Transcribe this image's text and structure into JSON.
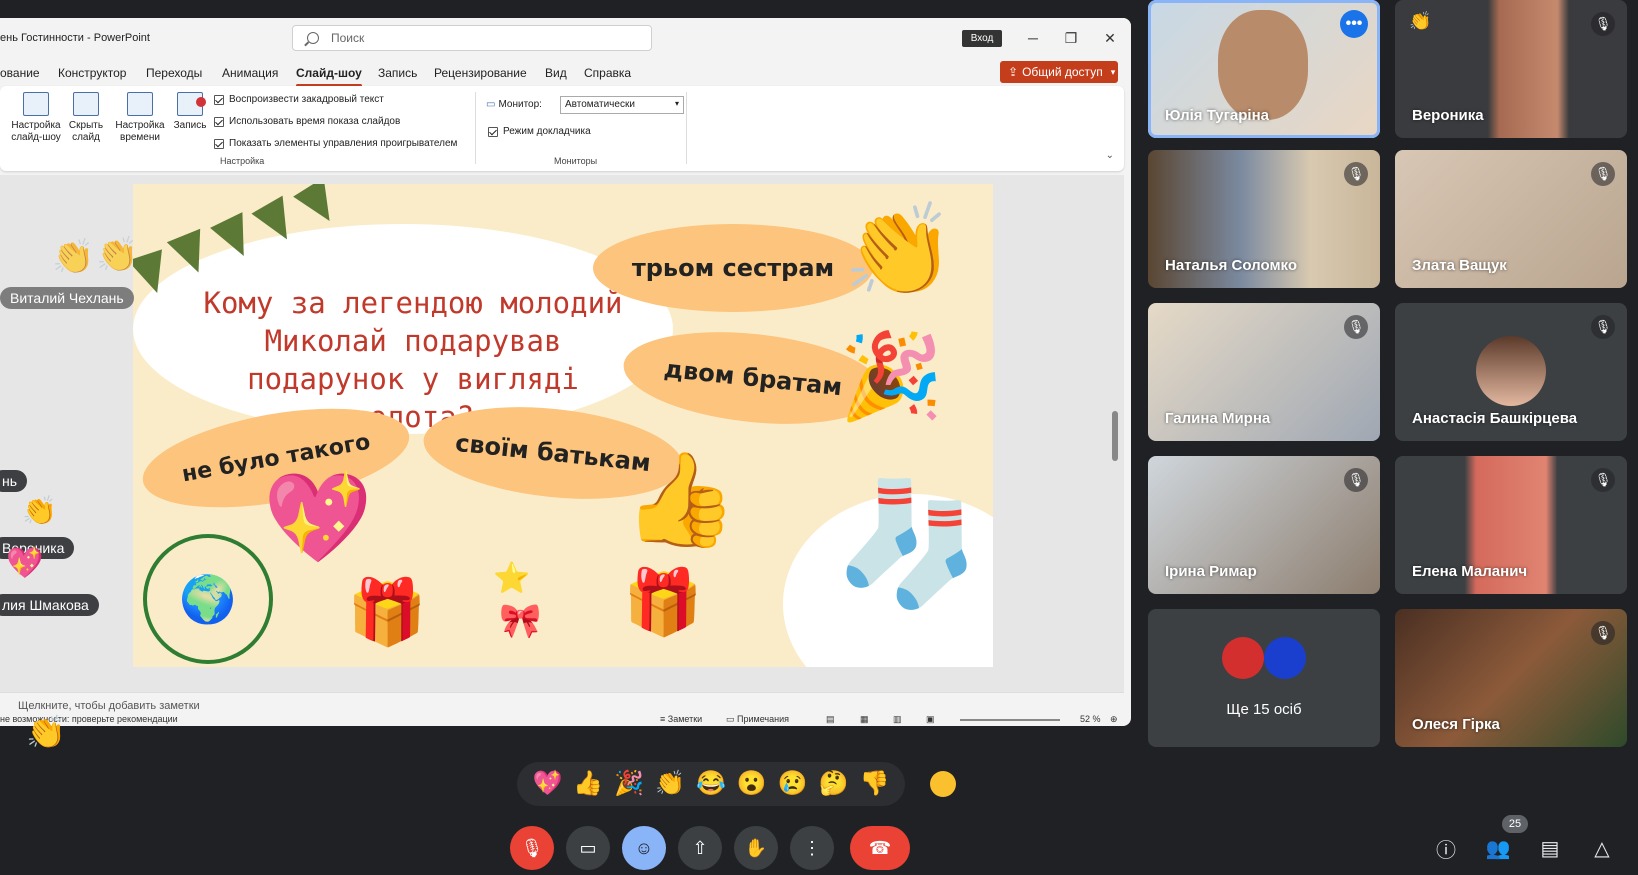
{
  "powerpoint": {
    "doc_title": "ень Гостинности  -  PowerPoint",
    "search_placeholder": "Поиск",
    "login_label": "Вход",
    "menu": [
      "ование",
      "Конструктор",
      "Переходы",
      "Анимация",
      "Слайд-шоу",
      "Запись",
      "Рецензирование",
      "Вид",
      "Справка"
    ],
    "active_menu": "Слайд-шоу",
    "share_label": "Общий доступ",
    "ribbon": {
      "btn_setup": "Настройка слайд-шоу",
      "btn_hide": "Скрыть слайд",
      "btn_rehearse": "Настройка времени",
      "btn_record": "Запись",
      "chk_narration": "Воспроизвести закадровый текст",
      "chk_timings": "Использовать время показа слайдов",
      "chk_controls": "Показать элементы управления проигрывателем",
      "group_setup": "Настройка",
      "monitor_label": "Монитор:",
      "monitor_value": "Автоматически",
      "presenter_view": "Режим докладчика",
      "group_monitors": "Мониторы"
    },
    "notes_placeholder": "Щелкните, чтобы добавить заметки",
    "status_accessibility": "не возможности: проверьте рекомендации",
    "status_notes": "Заметки",
    "status_comments": "Примечания",
    "zoom": "52 %"
  },
  "slide": {
    "question": "Кому за легендою молодий Миколай подарував подарунок у вигляді золота?",
    "answer_1": "трьом сестрам",
    "answer_2": "двом братам",
    "answer_3": "не було такого",
    "answer_4": "своїм батькам"
  },
  "overlay": {
    "chip_1": "Виталий Чехлань",
    "chip_2": "нь",
    "chip_3": "Вероника",
    "chip_4": "лия Шмакова"
  },
  "participants": [
    {
      "name": "Юлія Тугаріна",
      "active": true
    },
    {
      "name": "Вероника"
    },
    {
      "name": "Наталья Соломко"
    },
    {
      "name": "Злата Ващук"
    },
    {
      "name": "Галина Мирна"
    },
    {
      "name": "Анастасія Башкірцева"
    },
    {
      "name": "Ірина Римар"
    },
    {
      "name": "Елена Маланич"
    },
    {
      "name": "Ще 15 осіб"
    },
    {
      "name": "Олеся Гірка"
    }
  ],
  "reactions": [
    "💖",
    "👍",
    "🎉",
    "👏",
    "😂",
    "😮",
    "😢",
    "🤔",
    "👎"
  ],
  "people_count": "25",
  "colors": {
    "meet_bg": "#202124",
    "end_call": "#ea4335",
    "accent_blue": "#8ab4f8",
    "ppt_accent": "#c43e1c",
    "slide_bg": "#fbecc9",
    "pill": "#fcc47c",
    "question_text": "#c0392b"
  }
}
